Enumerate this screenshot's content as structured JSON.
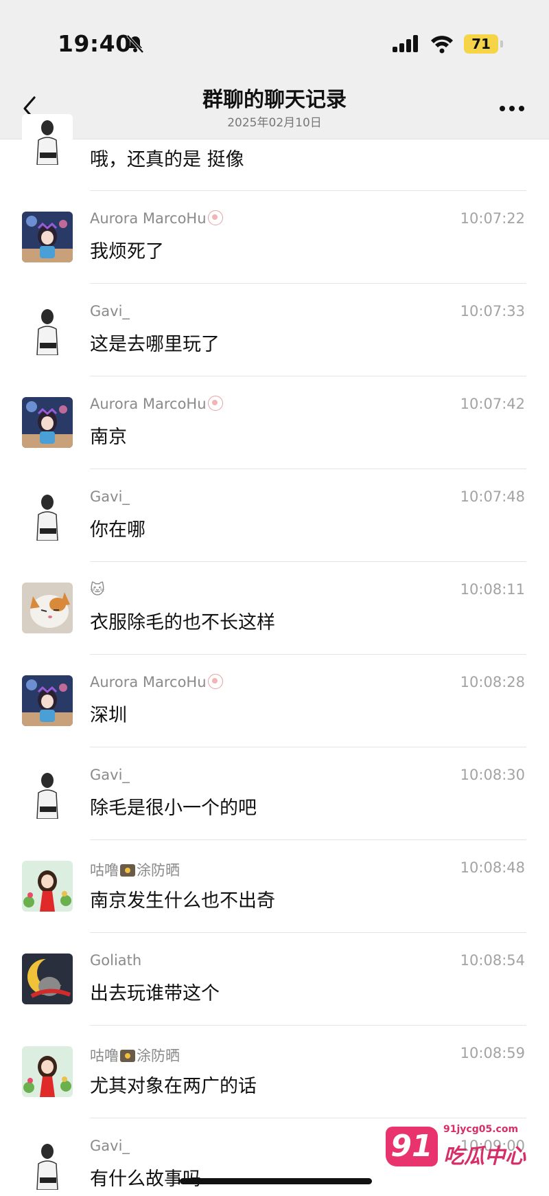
{
  "status_bar": {
    "time": "19:40",
    "battery": "71"
  },
  "header": {
    "title": "群聊的聊天记录",
    "subtitle": "2025年02月10日"
  },
  "messages": [
    {
      "sender": "",
      "time": "",
      "text": "哦，还真的是 挺像",
      "avatar": "man-sketch"
    },
    {
      "sender": "Aurora MarcoHu",
      "time": "10:07:22",
      "text": "我烦死了",
      "avatar": "anime-girl"
    },
    {
      "sender": "Gavi_",
      "time": "10:07:33",
      "text": "这是去哪里玩了",
      "avatar": "man-sketch"
    },
    {
      "sender": "Aurora MarcoHu",
      "time": "10:07:42",
      "text": "南京",
      "avatar": "anime-girl"
    },
    {
      "sender": "Gavi_",
      "time": "10:07:48",
      "text": "你在哪",
      "avatar": "man-sketch"
    },
    {
      "sender": "🐱",
      "time": "10:08:11",
      "text": "衣服除毛的也不长这样",
      "avatar": "cat-photo"
    },
    {
      "sender": "Aurora MarcoHu",
      "time": "10:08:28",
      "text": "深圳",
      "avatar": "anime-girl"
    },
    {
      "sender": "Gavi_",
      "time": "10:08:30",
      "text": "除毛是很小一个的吧",
      "avatar": "man-sketch"
    },
    {
      "sender_a": "咕噜",
      "sender_b": "涂防晒",
      "time": "10:08:48",
      "text": "南京发生什么也不出奇",
      "avatar": "cartoon-girl"
    },
    {
      "sender": "Goliath",
      "time": "10:08:54",
      "text": "出去玩谁带这个",
      "avatar": "moon-cat"
    },
    {
      "sender_a": "咕噜",
      "sender_b": "涂防晒",
      "time": "10:08:59",
      "text": "尤其对象在两广的话",
      "avatar": "cartoon-girl"
    },
    {
      "sender": "Gavi_",
      "time": "10:09:00",
      "text": "有什么故事吗",
      "avatar": "man-sketch"
    }
  ],
  "watermark": {
    "logo": "91",
    "url": "91jycg05.com",
    "name": "吃瓜中心"
  }
}
